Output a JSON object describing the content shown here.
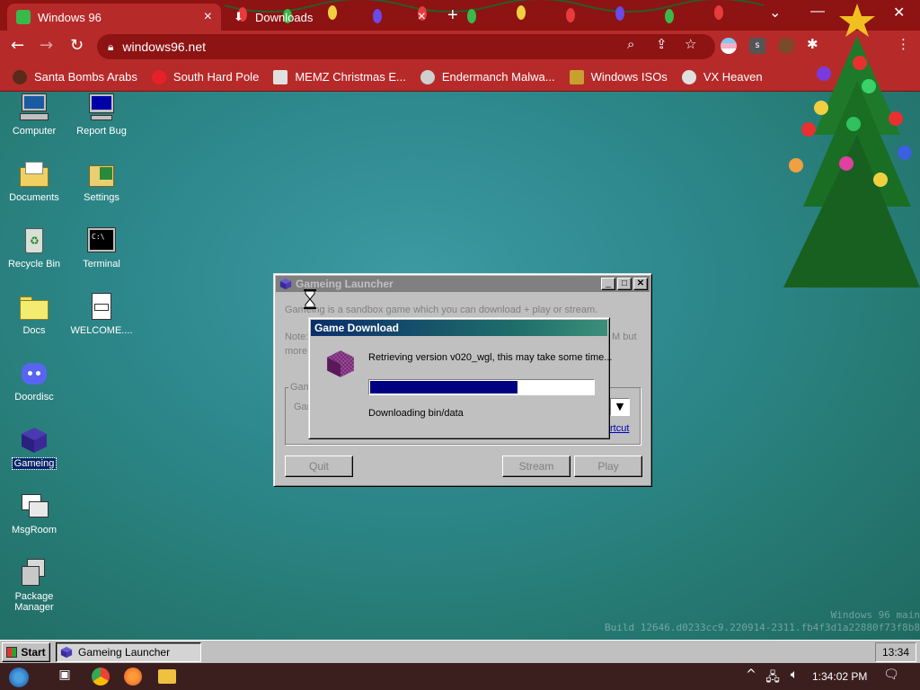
{
  "browser": {
    "tabs": [
      {
        "label": "Windows 96",
        "active": true
      },
      {
        "label": "Downloads",
        "active": false
      }
    ],
    "new_tab_label": "+",
    "window_controls": {
      "dropdown": "⌄",
      "minimize": "—",
      "close": "✕"
    },
    "url": "windows96.net",
    "nav": {
      "back": "←",
      "forward": "→",
      "reload": "↻"
    },
    "extension_letter": "s",
    "bookmarks": [
      {
        "label": "Santa Bombs Arabs",
        "icon": "bomb-icon"
      },
      {
        "label": "South Hard Pole",
        "icon": "snowflake-icon"
      },
      {
        "label": "MEMZ Christmas E...",
        "icon": "memz-icon"
      },
      {
        "label": "Endermanch Malwa...",
        "icon": "raccoon-icon"
      },
      {
        "label": "Windows ISOs",
        "icon": "trophy-icon"
      },
      {
        "label": "VX Heaven",
        "icon": "shield-icon"
      }
    ]
  },
  "desktop": {
    "icons": [
      {
        "label": "Computer"
      },
      {
        "label": "Report Bug"
      },
      {
        "label": "Documents"
      },
      {
        "label": "Settings"
      },
      {
        "label": "Recycle Bin"
      },
      {
        "label": "Terminal"
      },
      {
        "label": "Docs"
      },
      {
        "label": "WELCOME...."
      },
      {
        "label": "Doordisc"
      },
      {
        "label": "Gameing"
      },
      {
        "label": "MsgRoom"
      },
      {
        "label": "Package Manager"
      }
    ],
    "watermark_line1": "Windows 96 main",
    "watermark_line2": "Build 12646.d0233cc9.220914-2311.fb4f3d1a22880f73f8b8"
  },
  "launcher": {
    "title": "Gameing Launcher",
    "description": "Gameing is a sandbox game which you can download + play or stream.",
    "note_start": "Note:",
    "note_line2": "more",
    "note_end": "M but",
    "group_label": "Game",
    "field_label": "Gar",
    "shortcut_link": "rtcut",
    "buttons": {
      "quit": "Quit",
      "stream": "Stream",
      "play": "Play"
    }
  },
  "download_dialog": {
    "title": "Game Download",
    "message": "Retrieving version v020_wgl, this may take some time...",
    "status": "Downloading bin/data",
    "progress_fraction": 0.66
  },
  "taskbar96": {
    "start_label": "Start",
    "task_label": "Gameing Launcher",
    "clock": "13:34"
  },
  "taskbar10": {
    "clock": "1:34:02 PM",
    "tray_up": "^"
  },
  "colors": {
    "chrome_dark": "#8e1313",
    "chrome": "#b72a2a",
    "win95_gray": "#c0c0c0",
    "progress": "#000080"
  }
}
